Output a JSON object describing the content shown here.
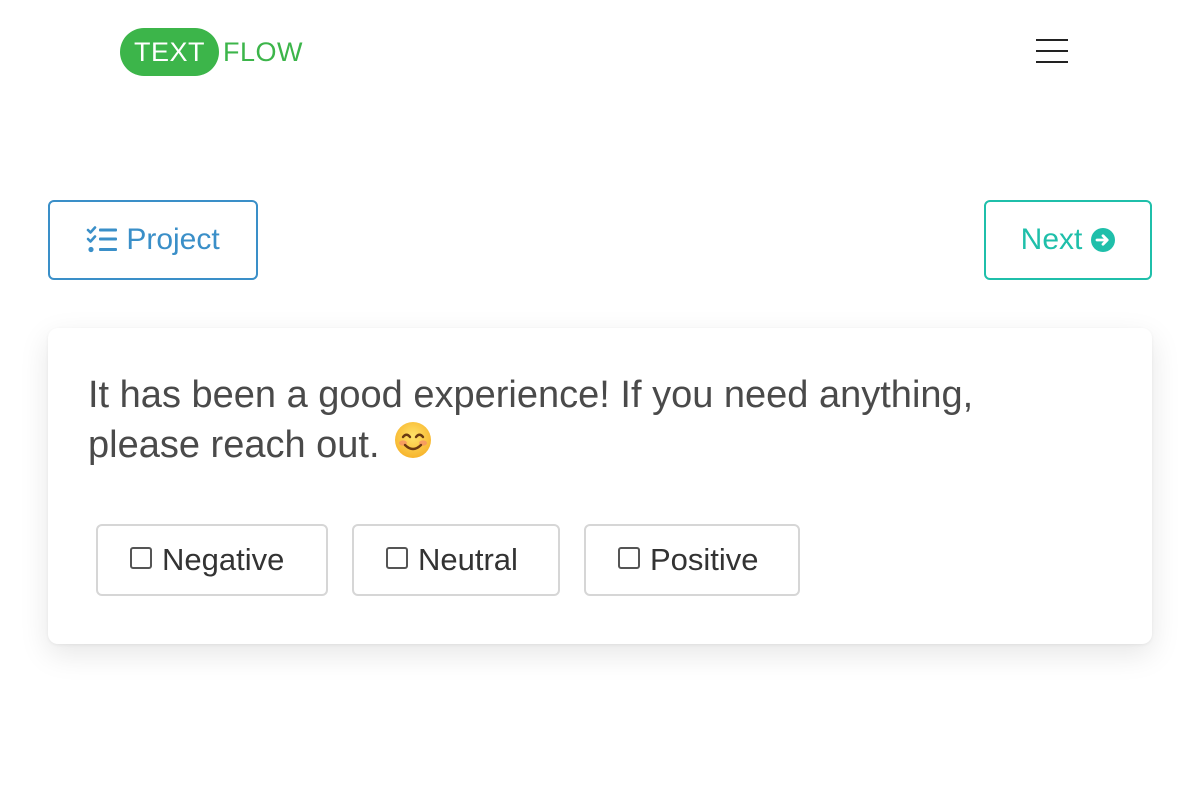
{
  "header": {
    "logo_pill_text": "TEXT",
    "logo_word_text": "FLOW",
    "menu_icon": "hamburger-menu-icon"
  },
  "actions": {
    "project_label": "Project",
    "project_icon": "task-list-icon",
    "next_label": "Next",
    "next_icon": "arrow-circle-right-icon"
  },
  "card": {
    "message_line1": "It has been a good experience! If you need anything,",
    "message_line2": "please reach out.",
    "message_emoji": "smiling-face-emoji",
    "options": [
      {
        "label": "Negative",
        "checked": false
      },
      {
        "label": "Neutral",
        "checked": false
      },
      {
        "label": "Positive",
        "checked": false
      }
    ]
  },
  "colors": {
    "brand_green": "#3cb54a",
    "project_blue": "#3a8fc8",
    "next_teal": "#1fbfaa",
    "text_gray": "#4a4a4a"
  }
}
